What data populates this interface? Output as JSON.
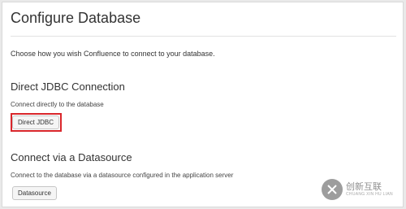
{
  "page": {
    "title": "Configure Database",
    "intro": "Choose how you wish Confluence to connect to your database."
  },
  "jdbc": {
    "heading": "Direct JDBC Connection",
    "description": "Connect directly to the database",
    "button_label": "Direct JDBC"
  },
  "datasource": {
    "heading": "Connect via a Datasource",
    "description": "Connect to the database via a datasource configured in the application server",
    "button_label": "Datasource"
  },
  "watermark": {
    "text_cn": "创新互联",
    "text_en": "CHUANG XIN HU LIAN"
  },
  "colors": {
    "highlight": "#d9262b"
  }
}
